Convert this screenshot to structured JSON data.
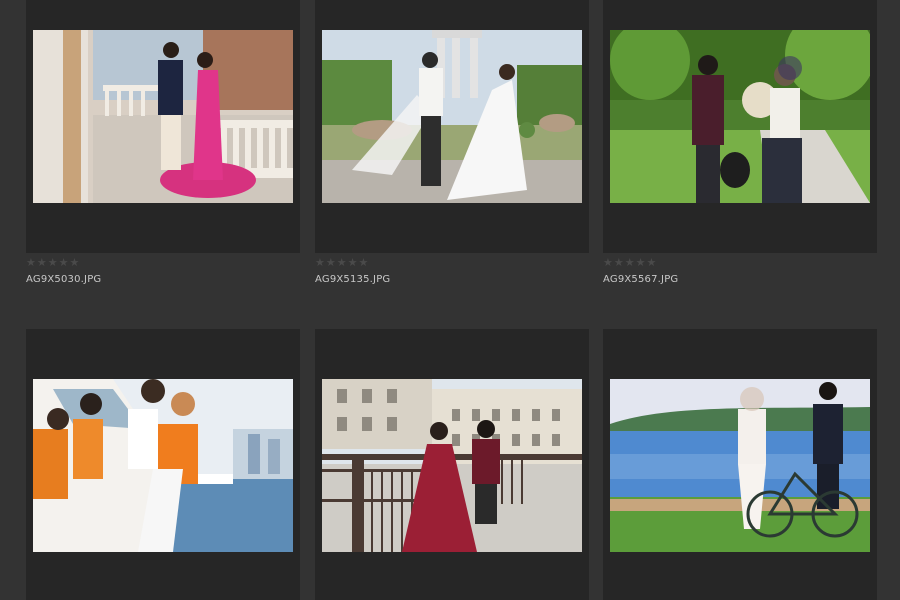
{
  "thumbnails": [
    {
      "filename": "AG9X5030.JPG",
      "rating": 0,
      "max_rating": 5,
      "scene": "pink-gown-balcony"
    },
    {
      "filename": "AG9X5135.JPG",
      "rating": 0,
      "max_rating": 5,
      "scene": "white-dress-garden"
    },
    {
      "filename": "AG9X5567.JPG",
      "rating": 0,
      "max_rating": 5,
      "scene": "park-path-couple"
    },
    {
      "filename": "",
      "rating": 0,
      "max_rating": 5,
      "scene": "orange-jackets-yacht"
    },
    {
      "filename": "",
      "rating": 0,
      "max_rating": 5,
      "scene": "red-gown-terrace"
    },
    {
      "filename": "",
      "rating": 0,
      "max_rating": 5,
      "scene": "lakeside-bicycle"
    }
  ],
  "colors": {
    "background": "#333333",
    "card": "#262626",
    "star_empty": "#4a4a4a",
    "filename_text": "#c8c8c8"
  }
}
